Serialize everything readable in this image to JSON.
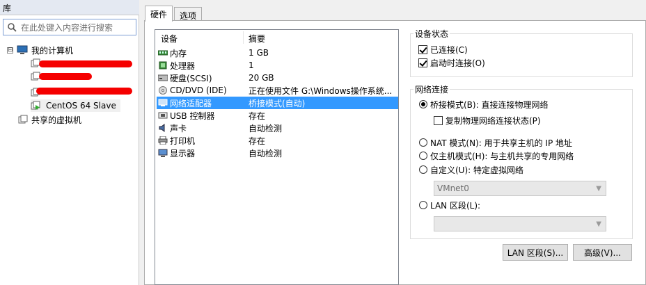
{
  "library": {
    "title": "库",
    "search_placeholder": "在此处键入内容进行搜索",
    "tree": {
      "root_label": "我的计算机",
      "root_toggle": "⊟",
      "vm_selected": "CentOS 64 Slave",
      "shared_label": "共享的虚拟机"
    }
  },
  "tabs": [
    {
      "label": "硬件"
    },
    {
      "label": "选项"
    }
  ],
  "device_list": {
    "col_device": "设备",
    "col_summary": "摘要",
    "rows": [
      {
        "name": "内存",
        "summary": "1 GB",
        "icon": "memory-icon"
      },
      {
        "name": "处理器",
        "summary": "1",
        "icon": "processor-icon"
      },
      {
        "name": "硬盘(SCSI)",
        "summary": "20 GB",
        "icon": "harddisk-icon"
      },
      {
        "name": "CD/DVD (IDE)",
        "summary": "正在使用文件 G:\\Windows操作系统...",
        "icon": "cd-dvd-icon"
      },
      {
        "name": "网络适配器",
        "summary": "桥接模式(自动)",
        "icon": "network-adapter-icon",
        "selected": true
      },
      {
        "name": "USB 控制器",
        "summary": "存在",
        "icon": "usb-icon"
      },
      {
        "name": "声卡",
        "summary": "自动检测",
        "icon": "sound-card-icon"
      },
      {
        "name": "打印机",
        "summary": "存在",
        "icon": "printer-icon"
      },
      {
        "name": "显示器",
        "summary": "自动检测",
        "icon": "display-icon"
      }
    ]
  },
  "device_status": {
    "title": "设备状态",
    "connected": "已连接(C)",
    "connect_at_power_on": "启动时连接(O)"
  },
  "network": {
    "title": "网络连接",
    "bridged": "桥接模式(B): 直接连接物理网络",
    "replicate": "复制物理网络连接状态(P)",
    "nat": "NAT 模式(N): 用于共享主机的 IP 地址",
    "host_only": "仅主机模式(H): 与主机共享的专用网络",
    "custom": "自定义(U): 特定虚拟网络",
    "custom_value": "VMnet0",
    "lan_segment": "LAN 区段(L):",
    "lan_value": ""
  },
  "buttons": {
    "lan_segments": "LAN 区段(S)...",
    "advanced": "高级(V)..."
  },
  "colors": {
    "selection": "#3399ff",
    "redaction": "#f50000"
  }
}
